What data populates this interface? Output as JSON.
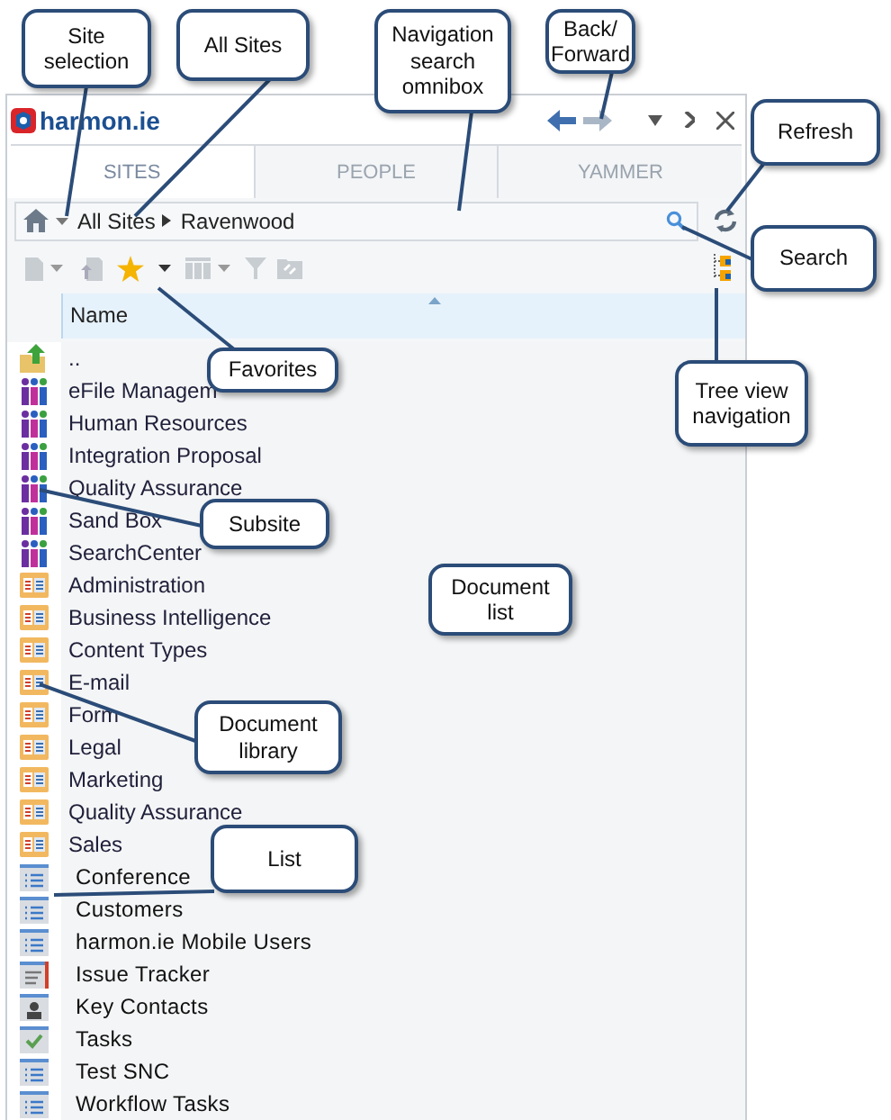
{
  "title_bar": {
    "logo": "harmon.ie"
  },
  "tabs": [
    {
      "label": "SITES",
      "selected": true
    },
    {
      "label": "PEOPLE",
      "selected": false
    },
    {
      "label": "YAMMER",
      "selected": false
    }
  ],
  "breadcrumb": {
    "root": "All Sites",
    "current": "Ravenwood"
  },
  "column_header": "Name",
  "rows": [
    {
      "kind": "up",
      "name": ".."
    },
    {
      "kind": "subsite",
      "name": "eFile Managem"
    },
    {
      "kind": "subsite",
      "name": "Human Resources"
    },
    {
      "kind": "subsite",
      "name": "Integration Proposal"
    },
    {
      "kind": "subsite",
      "name": "Quality Assurance"
    },
    {
      "kind": "subsite",
      "name": "Sand Box"
    },
    {
      "kind": "subsite",
      "name": "SearchCenter"
    },
    {
      "kind": "library",
      "name": "Administration"
    },
    {
      "kind": "library",
      "name": "Business Intelligence"
    },
    {
      "kind": "library",
      "name": "Content Types"
    },
    {
      "kind": "library",
      "name": "E-mail"
    },
    {
      "kind": "library",
      "name": "Form"
    },
    {
      "kind": "library",
      "name": "Legal"
    },
    {
      "kind": "library",
      "name": "Marketing"
    },
    {
      "kind": "library",
      "name": "Quality Assurance"
    },
    {
      "kind": "library",
      "name": "Sales"
    },
    {
      "kind": "list",
      "name": "Conference"
    },
    {
      "kind": "list",
      "name": "Customers"
    },
    {
      "kind": "list",
      "name": "harmon.ie Mobile Users"
    },
    {
      "kind": "issues",
      "name": "Issue Tracker"
    },
    {
      "kind": "contacts",
      "name": "Key Contacts"
    },
    {
      "kind": "tasks",
      "name": "Tasks"
    },
    {
      "kind": "list",
      "name": "Test SNC"
    },
    {
      "kind": "list",
      "name": "Workflow Tasks"
    }
  ],
  "callouts": [
    {
      "label": "Site selection"
    },
    {
      "label": "All Sites"
    },
    {
      "label": "Navigation search omnibox"
    },
    {
      "label": "Back/ Forward"
    },
    {
      "label": "Refresh"
    },
    {
      "label": "Search"
    },
    {
      "label": "Tree view navigation"
    },
    {
      "label": "Favorites"
    },
    {
      "label": "Subsite"
    },
    {
      "label": "Document list"
    },
    {
      "label": "Document library"
    },
    {
      "label": "List"
    }
  ]
}
